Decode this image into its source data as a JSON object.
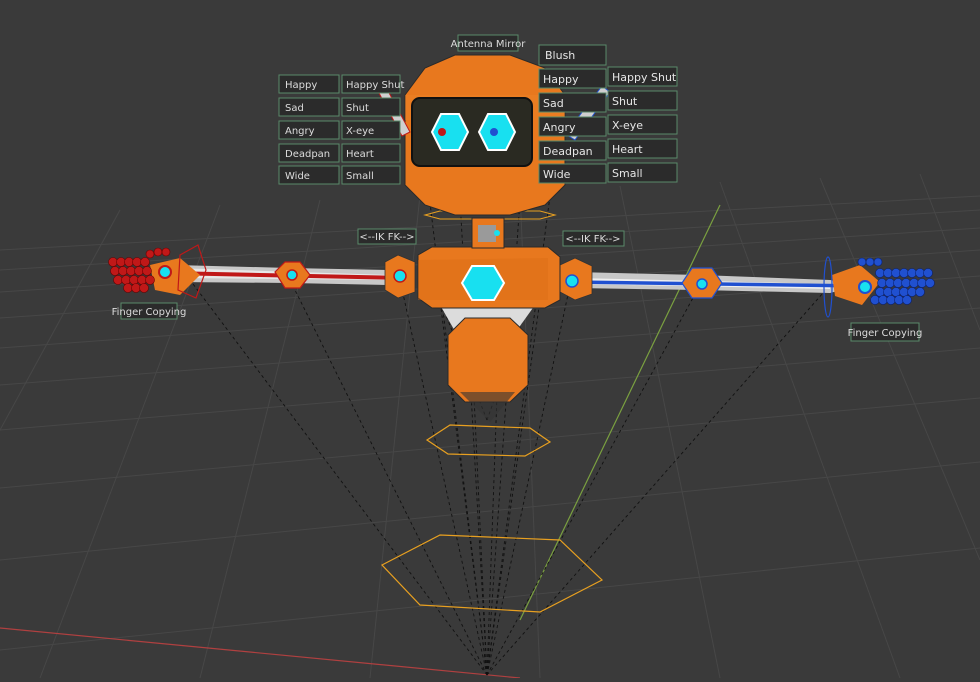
{
  "viewport": {
    "colors": {
      "background": "#3a3a3a",
      "grid": "#4a4a4a",
      "x_axis": "#b04040",
      "y_axis": "#7aa040",
      "robot_orange": "#e8781e",
      "screen_cyan": "#18e0f0",
      "left_rig": "#c01818",
      "right_rig": "#2050d0",
      "selection": "#e8a020"
    }
  },
  "labels": {
    "antenna_mirror": "Antenna Mirror",
    "left_expressions": [
      "Happy",
      "Sad",
      "Angry",
      "Deadpan",
      "Wide"
    ],
    "left_eye_options": [
      "Happy Shut",
      "Shut",
      "X-eye",
      "Heart",
      "Small"
    ],
    "right_blush": "Blush",
    "right_expressions": [
      "Happy",
      "Sad",
      "Angry",
      "Deadpan",
      "Wide"
    ],
    "right_eye_options": [
      "Happy Shut",
      "Shut",
      "X-eye",
      "Heart",
      "Small"
    ],
    "left_ikfk": "<--IK  FK-->",
    "right_ikfk": "<--IK  FK-->",
    "left_finger": "Finger Copying",
    "right_finger": "Finger Copying"
  }
}
